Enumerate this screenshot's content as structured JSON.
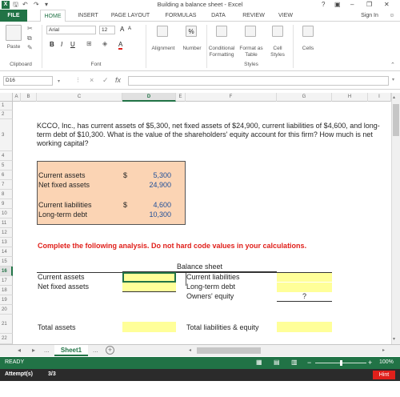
{
  "window": {
    "title": "Building a balance sheet - Excel",
    "help": "?",
    "sign_in": "Sign In"
  },
  "tabs": [
    {
      "label": "FILE"
    },
    {
      "label": "HOME"
    },
    {
      "label": "INSERT"
    },
    {
      "label": "PAGE LAYOUT"
    },
    {
      "label": "FORMULAS"
    },
    {
      "label": "DATA"
    },
    {
      "label": "REVIEW"
    },
    {
      "label": "VIEW"
    }
  ],
  "ribbon": {
    "paste": "Paste",
    "clipboard": "Clipboard",
    "font_name": "Arial",
    "font_size": "12",
    "font_group": "Font",
    "alignment": "Alignment",
    "number": "Number",
    "percent": "%",
    "conditional": "Conditional",
    "formatting": "Formatting",
    "format_as": "Format as",
    "table": "Table",
    "cell": "Cell",
    "styles_l": "Styles",
    "styles_group": "Styles",
    "cells": "Cells",
    "bold": "B",
    "italic": "I",
    "underline": "U",
    "grow": "A",
    "shrink": "A",
    "font_color": "A"
  },
  "formula_bar": {
    "name_box": "D16",
    "cancel": "×",
    "enter": "✓",
    "fx": "fx",
    "value": ""
  },
  "columns": [
    "A",
    "B",
    "C",
    "D",
    "E",
    "F",
    "G",
    "H",
    "I"
  ],
  "rows": [
    "1",
    "2",
    "3",
    "4",
    "5",
    "6",
    "7",
    "8",
    "9",
    "10",
    "11",
    "12",
    "13",
    "14",
    "15",
    "16",
    "17",
    "18",
    "19",
    "20",
    "21",
    "22"
  ],
  "sheet": {
    "problem": "KCCO, Inc., has current assets of $5,300, net fixed assets of $24,900, current liabilities of $4,600, and long-term debt of $10,300. What is the value of the shareholders' equity account for this firm? How much is net working capital?",
    "given": {
      "current_assets_label": "Current assets",
      "current_assets_cur": "$",
      "current_assets_val": "5,300",
      "net_fixed_label": "Net fixed assets",
      "net_fixed_val": "24,900",
      "current_liab_label": "Current liabilities",
      "current_liab_cur": "$",
      "current_liab_val": "4,600",
      "ltd_label": "Long-term debt",
      "ltd_val": "10,300"
    },
    "instruction": "Complete the following analysis. Do not hard code values in your calculations.",
    "bs_title": "Balance sheet",
    "bs_current_assets": "Current assets",
    "bs_net_fixed": "Net fixed assets",
    "bs_current_liab": "Current liabilities",
    "bs_ltd": "Long-term debt",
    "bs_equity": "Owners' equity",
    "bs_equity_value": "?",
    "bs_total_assets": "Total assets",
    "bs_total_le": "Total liabilities & equity"
  },
  "sheet_tabs": {
    "prev": "◂",
    "next": "▸",
    "more": "...",
    "active": "Sheet1",
    "more2": "...",
    "add": "+"
  },
  "status": {
    "ready": "READY",
    "zoom": "100%",
    "minus": "−",
    "plus": "+"
  },
  "attempt": {
    "label": "Attempt(s)",
    "value": "3/3",
    "hint": "Hint"
  },
  "colors": {
    "excel_green": "#217346",
    "given_fill": "#fbd4b4",
    "input_fill": "#ffff99",
    "instruction": "#e0201b",
    "hint": "#e0201b"
  }
}
